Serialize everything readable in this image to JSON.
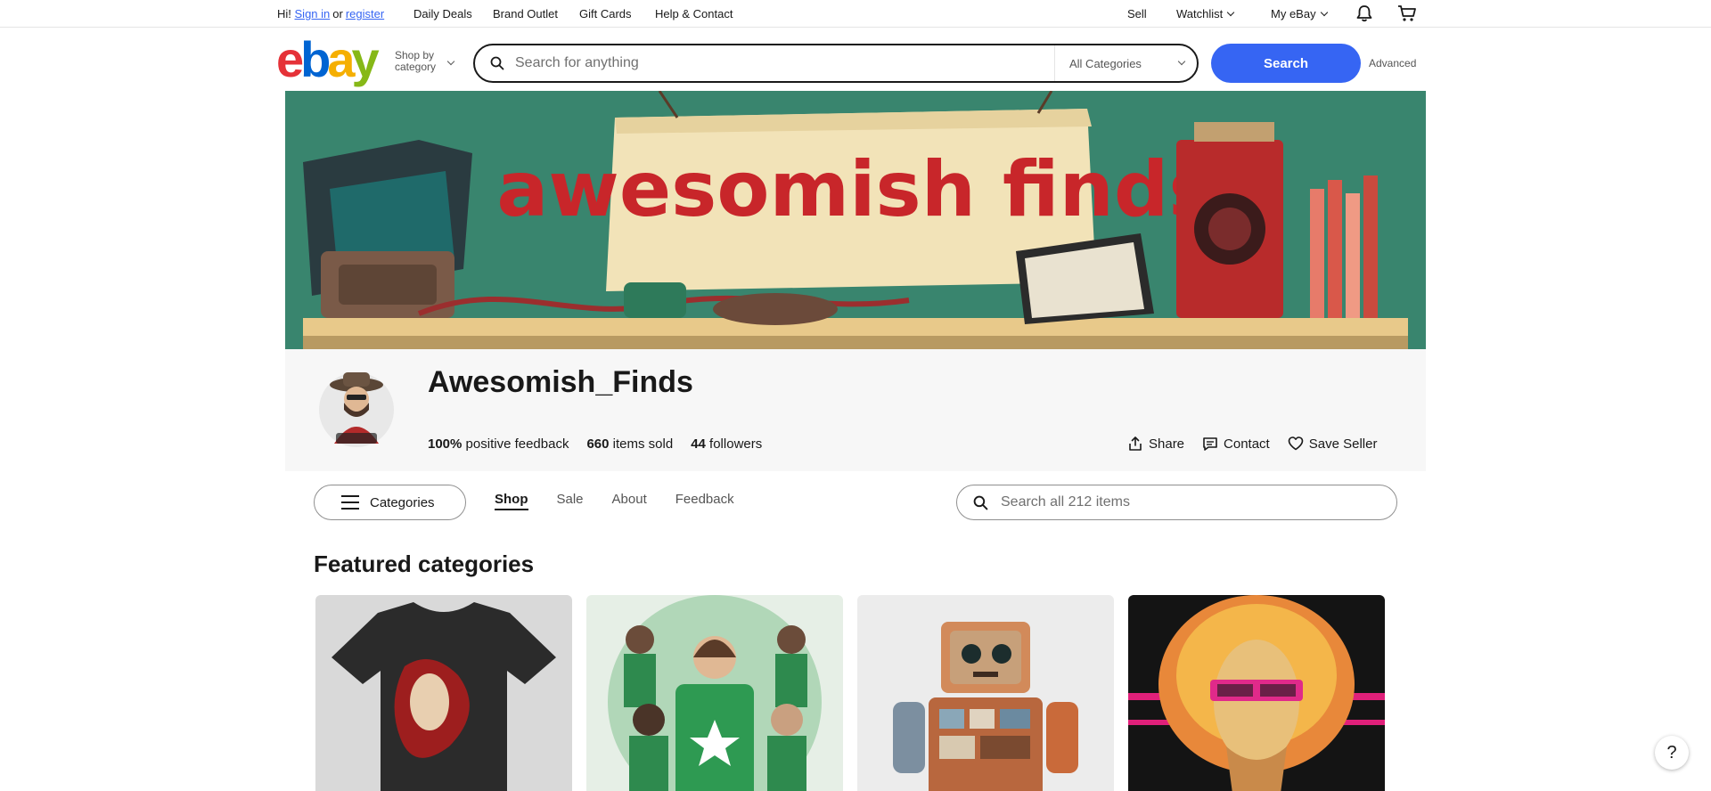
{
  "topbar": {
    "greeting": "Hi!",
    "sign_in": "Sign in",
    "or": "or",
    "register": "register",
    "nav": [
      "Daily Deals",
      "Brand Outlet",
      "Gift Cards",
      "Help & Contact"
    ],
    "sell": "Sell",
    "watchlist": "Watchlist",
    "my_ebay": "My eBay"
  },
  "header": {
    "logo": [
      "e",
      "b",
      "a",
      "y"
    ],
    "shop_by_line1": "Shop by",
    "shop_by_line2": "category",
    "search_placeholder": "Search for anything",
    "category_select": "All Categories",
    "search_button": "Search",
    "advanced": "Advanced"
  },
  "banner": {
    "text": "awesomish finds"
  },
  "store": {
    "name": "Awesomish_Finds",
    "feedback_value": "100%",
    "feedback_label": "positive feedback",
    "sold_value": "660",
    "sold_label": "items sold",
    "followers_value": "44",
    "followers_label": "followers",
    "share": "Share",
    "contact": "Contact",
    "save_seller": "Save Seller"
  },
  "storenav": {
    "categories": "Categories",
    "tabs": [
      "Shop",
      "Sale",
      "About",
      "Feedback"
    ],
    "search_placeholder": "Search all 212 items"
  },
  "featured": {
    "title": "Featured categories"
  },
  "help": "?"
}
